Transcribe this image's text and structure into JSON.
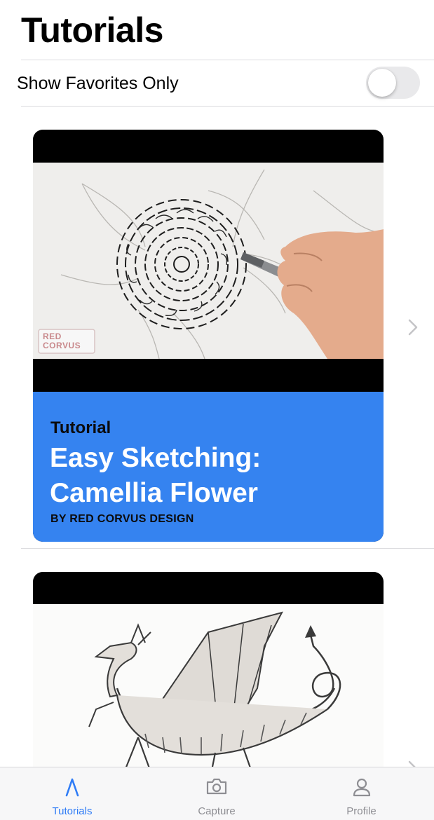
{
  "header": {
    "title": "Tutorials"
  },
  "favorites": {
    "label": "Show Favorites Only",
    "enabled": false
  },
  "tutorials": [
    {
      "kicker": "Tutorial",
      "title": "Easy Sketching: Camellia Flower",
      "byline": "BY RED CORVUS DESIGN",
      "watermark": "RED CORVUS"
    },
    {
      "kicker": "",
      "title": "",
      "byline": ""
    }
  ],
  "tab_bar": {
    "tabs": [
      {
        "label": "Tutorials",
        "icon": "tutorials-a-icon",
        "active": true
      },
      {
        "label": "Capture",
        "icon": "camera-icon",
        "active": false
      },
      {
        "label": "Profile",
        "icon": "person-icon",
        "active": false
      }
    ]
  },
  "colors": {
    "accent": "#3583f0",
    "active_tab": "#2f7cf6",
    "inactive_tab": "#8e8e93"
  }
}
